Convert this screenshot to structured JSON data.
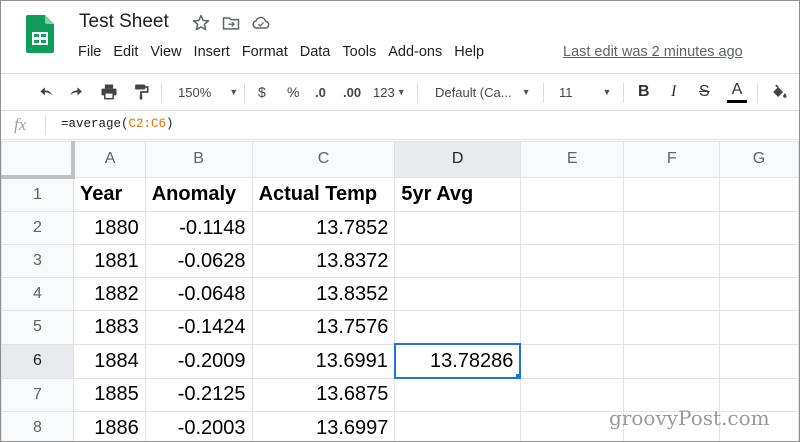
{
  "doc": {
    "title": "Test Sheet"
  },
  "menu": [
    "File",
    "Edit",
    "View",
    "Insert",
    "Format",
    "Data",
    "Tools",
    "Add-ons",
    "Help"
  ],
  "last_edit": "Last edit was 2 minutes ago",
  "toolbar": {
    "zoom": "150%",
    "currency": "$",
    "percent": "%",
    "dec_decrease": ".0",
    "dec_increase": ".00",
    "more_formats": "123",
    "font": "Default (Ca...",
    "font_size": "11",
    "bold": "B",
    "italic": "I",
    "strike": "S",
    "text_color": "A"
  },
  "formula_bar": {
    "fx": "fx",
    "prefix": "=average(",
    "range": "C2:C6",
    "suffix": ")"
  },
  "columns": [
    "A",
    "B",
    "C",
    "D",
    "E",
    "F",
    "G"
  ],
  "rows": [
    {
      "n": "1",
      "cells": [
        "Year",
        "Anomaly",
        "Actual Temp",
        "5yr Avg"
      ]
    },
    {
      "n": "2",
      "cells": [
        "1880",
        "-0.1148",
        "13.7852",
        ""
      ]
    },
    {
      "n": "3",
      "cells": [
        "1881",
        "-0.0628",
        "13.8372",
        ""
      ]
    },
    {
      "n": "4",
      "cells": [
        "1882",
        "-0.0648",
        "13.8352",
        ""
      ]
    },
    {
      "n": "5",
      "cells": [
        "1883",
        "-0.1424",
        "13.7576",
        ""
      ]
    },
    {
      "n": "6",
      "cells": [
        "1884",
        "-0.2009",
        "13.6991",
        "13.78286"
      ]
    },
    {
      "n": "7",
      "cells": [
        "1885",
        "-0.2125",
        "13.6875",
        ""
      ]
    },
    {
      "n": "8",
      "cells": [
        "1886",
        "-0.2003",
        "13.6997",
        ""
      ]
    }
  ],
  "watermark": "groovyPost.com",
  "colors": {
    "accent": "#1a73e8",
    "logo": "#0f9d58",
    "range": "#e37400"
  }
}
